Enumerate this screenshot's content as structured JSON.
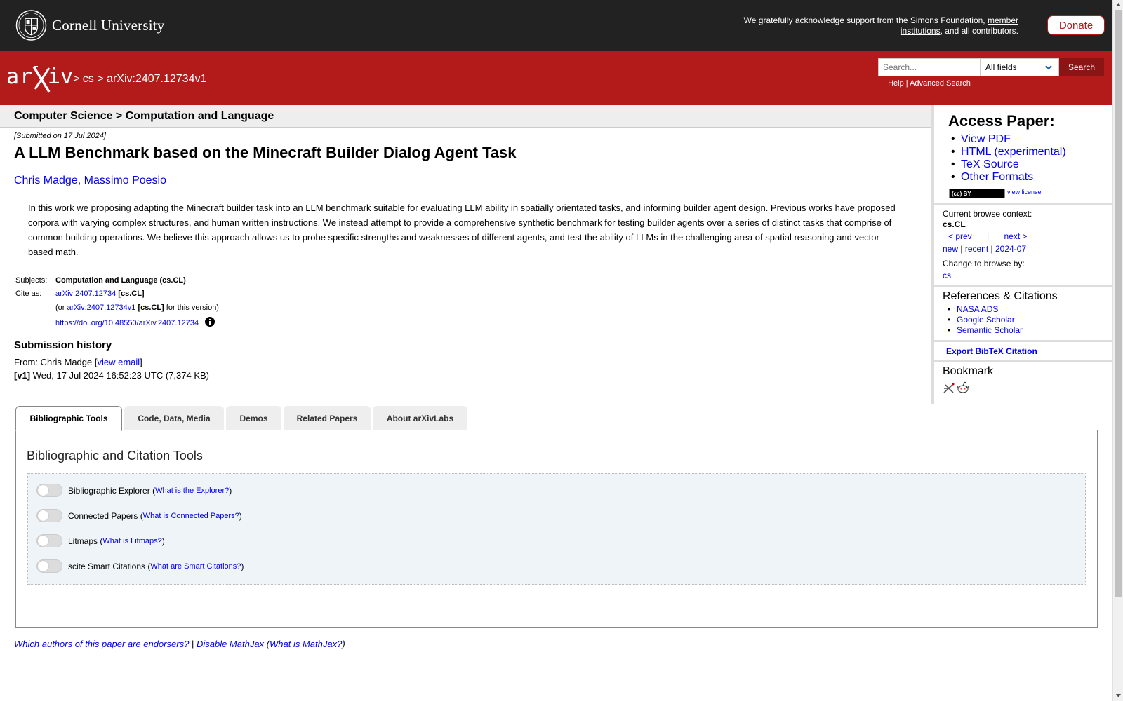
{
  "header": {
    "institution": "Cornell University",
    "support_text": "We gratefully acknowledge support from the Simons Foundation,",
    "support_link": "member institutions",
    "support_tail": ", and all contributors.",
    "donate_label": "Donate"
  },
  "nav": {
    "sep1": ">",
    "crumb_cs": "cs",
    "sep2": ">",
    "crumb_id": "arXiv:2407.12734v1",
    "search_placeholder": "Search...",
    "search_field": "All fields",
    "search_button": "Search",
    "help_link": "Help",
    "links_sep": "|",
    "advanced_link": "Advanced Search"
  },
  "subject_bar": "Computer Science > Computation and Language",
  "paper": {
    "submitted": "[Submitted on 17 Jul 2024]",
    "title": "A LLM Benchmark based on the Minecraft Builder Dialog Agent Task",
    "authors": [
      "Chris Madge",
      "Massimo Poesio"
    ],
    "author_sep": ",",
    "abstract": "In this work we proposing adapting the Minecraft builder task into an LLM benchmark suitable for evaluating LLM ability in spatially orientated tasks, and informing builder agent design. Previous works have proposed corpora with varying complex structures, and human written instructions. We instead attempt to provide a comprehensive synthetic benchmark for testing builder agents over a series of distinct tasks that comprise of common building operations. We believe this approach allows us to probe specific strengths and weaknesses of different agents, and test the ability of LLMs in the challenging area of spatial reasoning and vector based math."
  },
  "metadata": {
    "subjects_label": "Subjects:",
    "subjects_value": "Computation and Language (cs.CL)",
    "cite_label": "Cite as:",
    "cite_id": "arXiv:2407.12734",
    "cite_cat": "[cs.CL]",
    "or_prefix": "(or",
    "version_id": "arXiv:2407.12734v1",
    "version_cat": "[cs.CL]",
    "version_suffix": "for this version)",
    "doi": "https://doi.org/10.48550/arXiv.2407.12734"
  },
  "history": {
    "title": "Submission history",
    "from_label": "From: Chris Madge [",
    "view_email": "view email",
    "from_close": "]",
    "v1_label": "[v1]",
    "v1_detail": "Wed, 17 Jul 2024 16:52:23 UTC (7,374 KB)"
  },
  "tabs": [
    "Bibliographic Tools",
    "Code, Data, Media",
    "Demos",
    "Related Papers",
    "About arXivLabs"
  ],
  "tools": {
    "panel_title": "Bibliographic and Citation Tools",
    "items": [
      {
        "label": "Bibliographic Explorer",
        "help": "What is the Explorer?"
      },
      {
        "label": "Connected Papers",
        "help": "What is Connected Papers?"
      },
      {
        "label": "Litmaps",
        "help": "What is Litmaps?"
      },
      {
        "label": "scite Smart Citations",
        "help": "What are Smart Citations?"
      }
    ]
  },
  "footer": {
    "endorsers": "Which authors of this paper are endorsers?",
    "sep": "|",
    "disable_mathjax": "Disable MathJax",
    "what_mathjax": "What is MathJax?"
  },
  "sidebar": {
    "access_title": "Access Paper:",
    "access_links": [
      "View PDF",
      "HTML (experimental)",
      "TeX Source",
      "Other Formats"
    ],
    "license_badge": "(cc) BY",
    "view_license": "view license",
    "context_label": "Current browse context:",
    "context_value": "cs.CL",
    "prev": "< prev",
    "pipe": "|",
    "next": "next >",
    "new": "new",
    "recent": "recent",
    "month": "2024-07",
    "change_label": "Change to browse by:",
    "change_cs": "cs",
    "refs_title": "References & Citations",
    "refs_links": [
      "NASA ADS",
      "Google Scholar",
      "Semantic Scholar"
    ],
    "bibtex": "Export BibTeX Citation",
    "bookmark_title": "Bookmark"
  },
  "colors": {
    "arxiv_red": "#b31b1b",
    "top_bar": "#222222",
    "link": "#0000ee"
  }
}
